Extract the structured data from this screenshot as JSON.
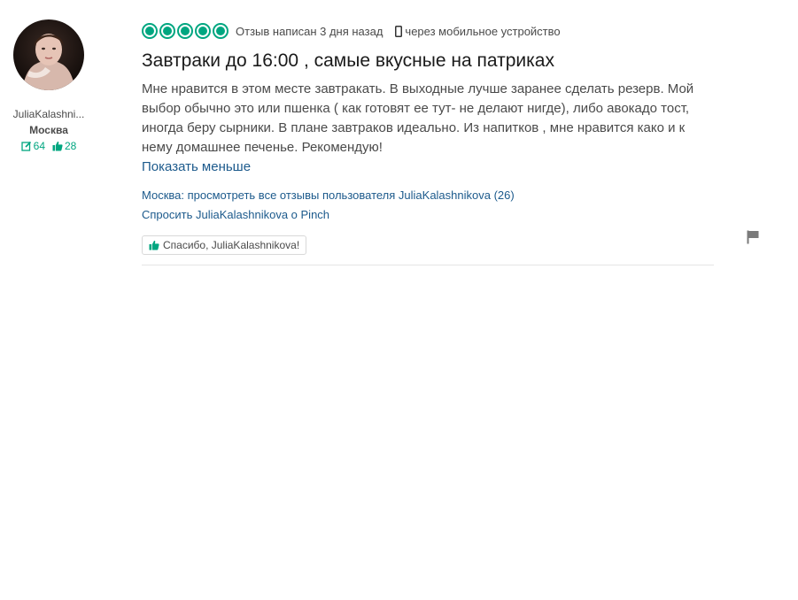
{
  "reviewer": {
    "username": "JuliaKalashni...",
    "location": "Москва",
    "review_count": "64",
    "helpful_votes": "28"
  },
  "review": {
    "rating": 5,
    "rating_max": 5,
    "date_text": "Отзыв написан 3 дня назад",
    "device_text": "через мобильное устройство",
    "title": "Завтраки до 16:00 , самые вкусные на патриках",
    "body": "Мне нравится в этом месте завтракать. В выходные лучше заранее сделать резерв. Мой выбор обычно это или пшенка ( как готовят ее тут- не делают нигде), либо авокадо тост, иногда беру сырники. В плане завтраков идеально. Из напитков , мне нравится како и к нему домашнее печенье. Рекомендую!",
    "show_less": "Показать меньше",
    "all_reviews_link": "Москва: просмотреть все отзывы пользователя JuliaKalashnikova (26)",
    "ask_link": "Спросить JuliaKalashnikova о Pinch",
    "thanks_button": "Спасибо, JuliaKalashnikova!"
  },
  "colors": {
    "accent": "#00a680",
    "link": "#1c5a8c",
    "text": "#4a4a4a",
    "title": "#1a1a1a"
  },
  "icons": {
    "review_count": "pencil-edit-icon",
    "helpful_votes": "thumbs-up-icon",
    "device": "mobile-phone-icon",
    "thanks": "thumbs-up-icon",
    "report": "flag-icon"
  }
}
